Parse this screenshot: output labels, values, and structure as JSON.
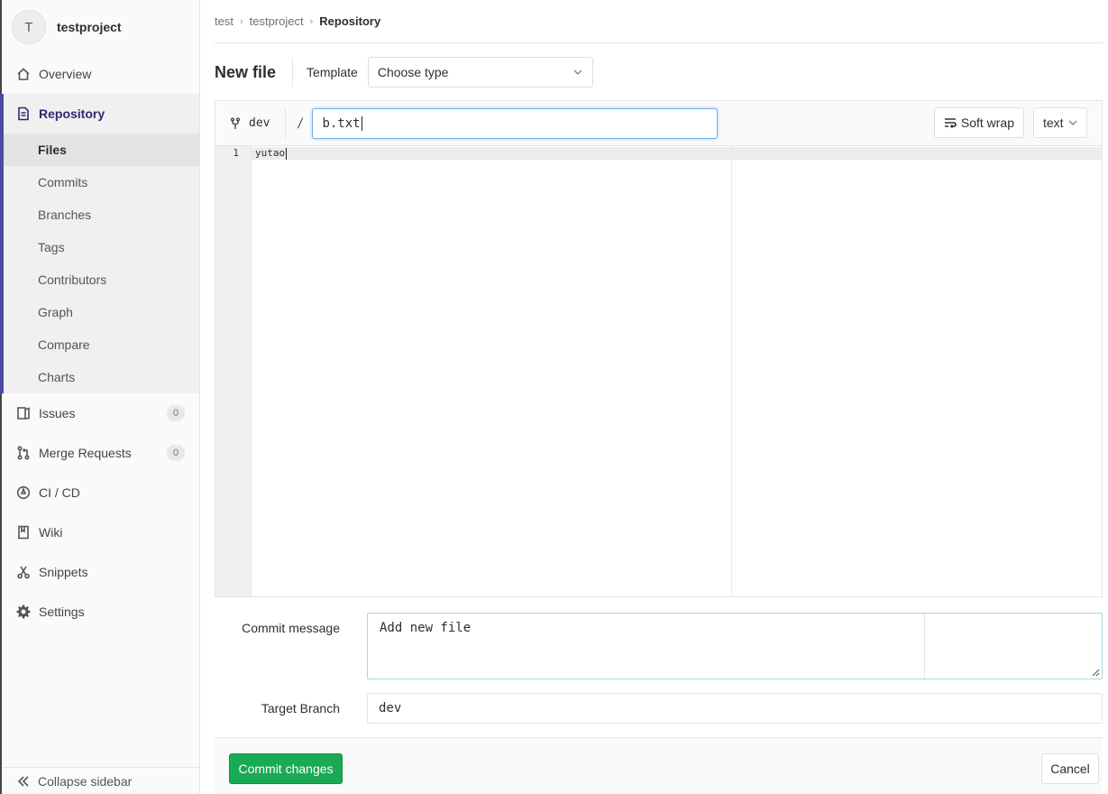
{
  "project": {
    "avatar_letter": "T",
    "name": "testproject"
  },
  "sidebar": {
    "overview": "Overview",
    "repository": "Repository",
    "repo_items": [
      "Files",
      "Commits",
      "Branches",
      "Tags",
      "Contributors",
      "Graph",
      "Compare",
      "Charts"
    ],
    "issues": {
      "label": "Issues",
      "count": "0"
    },
    "merge_requests": {
      "label": "Merge Requests",
      "count": "0"
    },
    "cicd": "CI / CD",
    "wiki": "Wiki",
    "snippets": "Snippets",
    "settings": "Settings",
    "collapse": "Collapse sidebar"
  },
  "breadcrumb": [
    "test",
    "testproject",
    "Repository"
  ],
  "page": {
    "title": "New file",
    "template_label": "Template",
    "template_value": "Choose type"
  },
  "editor": {
    "branch": "dev",
    "slash": "/",
    "file_name": "b.txt",
    "soft_wrap": "Soft wrap",
    "mode": "text",
    "line_number": "1",
    "content": "yutao"
  },
  "commit": {
    "message_label": "Commit message",
    "message_value": "Add new file",
    "target_label": "Target Branch",
    "target_value": "dev",
    "commit_button": "Commit changes",
    "cancel_button": "Cancel"
  },
  "colors": {
    "accent": "#4b4ba3",
    "commit_green": "#1aaa55",
    "focus_blue": "#73afea"
  }
}
